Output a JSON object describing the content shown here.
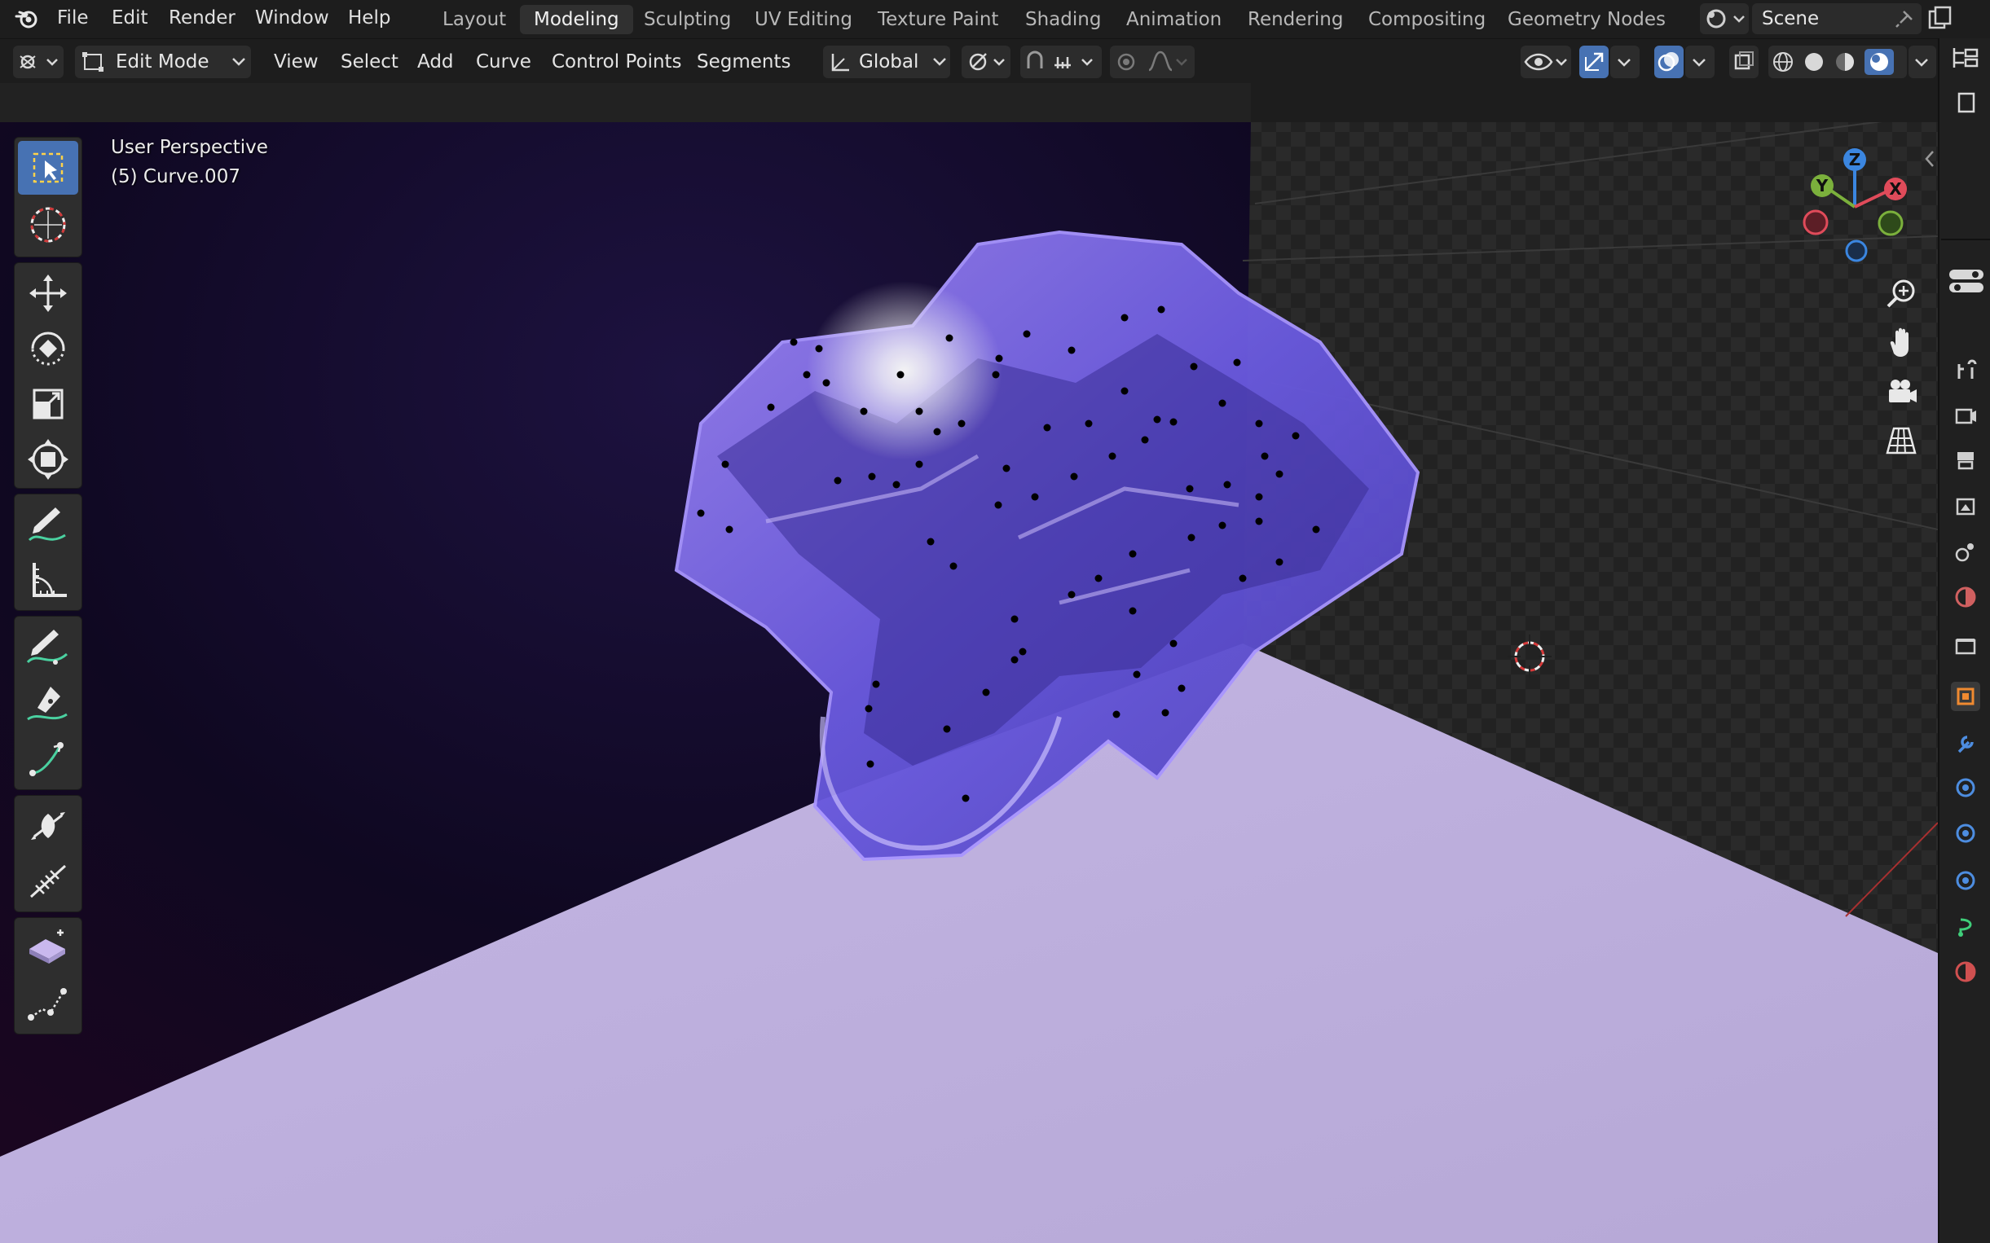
{
  "app": {
    "name": "Blender"
  },
  "menu": [
    "File",
    "Edit",
    "Render",
    "Window",
    "Help"
  ],
  "workspaces": {
    "tabs": [
      "Layout",
      "Modeling",
      "Sculpting",
      "UV Editing",
      "Texture Paint",
      "Shading",
      "Animation",
      "Rendering",
      "Compositing",
      "Geometry Nodes"
    ],
    "active": "Modeling"
  },
  "scene": {
    "name": "Scene"
  },
  "header": {
    "mode": "Edit Mode",
    "menus": [
      "View",
      "Select",
      "Add",
      "Curve",
      "Control Points",
      "Segments"
    ],
    "transform_orientation": "Global"
  },
  "viewport": {
    "view_name": "User Perspective",
    "object_label": "(5) Curve.007",
    "gizmo": {
      "z": "Z",
      "y": "Y",
      "x": "X"
    }
  },
  "tools": [
    {
      "name": "select-box-tool",
      "active": true
    },
    {
      "name": "cursor-tool"
    },
    {
      "name": "move-tool"
    },
    {
      "name": "rotate-tool"
    },
    {
      "name": "scale-tool"
    },
    {
      "name": "transform-tool"
    },
    {
      "name": "annotate-tool"
    },
    {
      "name": "measure-tool"
    },
    {
      "name": "draw-curve-tool"
    },
    {
      "name": "pen-tool"
    },
    {
      "name": "extrude-tool"
    },
    {
      "name": "radius-tool"
    },
    {
      "name": "tilt-tool"
    },
    {
      "name": "randomize-tool"
    },
    {
      "name": "curve-vertex-tool"
    }
  ],
  "colors": {
    "accent": "#4772b3",
    "floor": "#bdb0dc",
    "wall": "#120a24",
    "letter": "#7a63e6",
    "axis_x": "#e04b5a",
    "axis_y": "#7bb03c",
    "axis_z": "#3b86e0"
  },
  "properties_tabs": [
    "tool",
    "render",
    "output",
    "view-layer",
    "scene",
    "world",
    "collection",
    "object",
    "modifiers",
    "particles",
    "physics",
    "constraints",
    "data",
    "material"
  ]
}
